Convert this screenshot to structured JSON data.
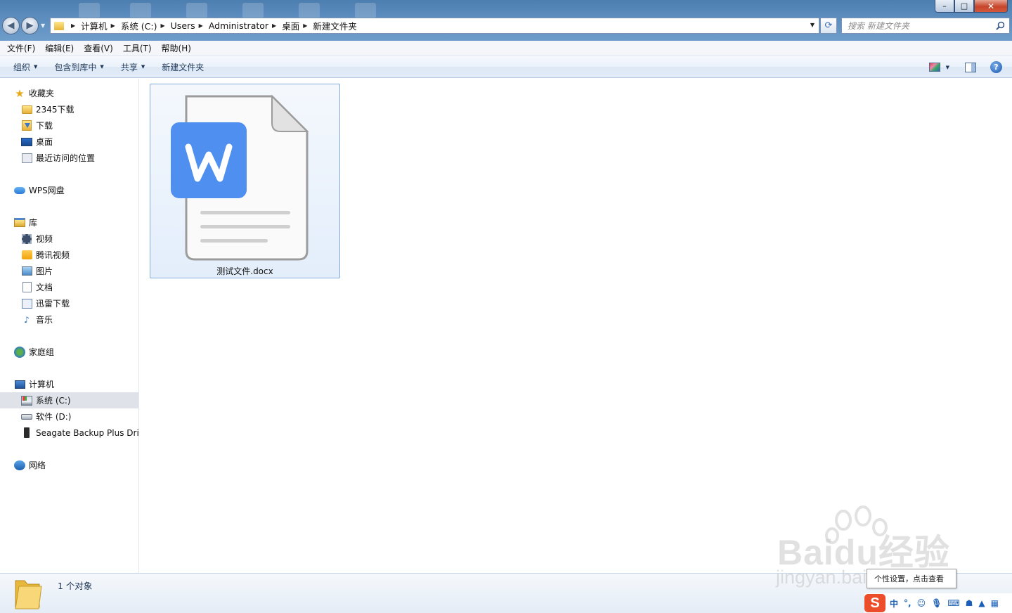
{
  "address": {
    "breadcrumbs": [
      "计算机",
      "系统 (C:)",
      "Users",
      "Administrator",
      "桌面",
      "新建文件夹"
    ]
  },
  "search": {
    "placeholder": "搜索 新建文件夹"
  },
  "window_controls": {
    "minimize": "–",
    "maximize": "□",
    "close": "✕"
  },
  "menubar": {
    "items": [
      "文件(F)",
      "编辑(E)",
      "查看(V)",
      "工具(T)",
      "帮助(H)"
    ]
  },
  "commandbar": {
    "organize": "组织",
    "include_in_library": "包含到库中",
    "share": "共享",
    "new_folder": "新建文件夹",
    "help": "?"
  },
  "sidebar": {
    "favorites": {
      "label": "收藏夹",
      "items": [
        "2345下载",
        "下载",
        "桌面",
        "最近访问的位置"
      ]
    },
    "wps_cloud": {
      "label": "WPS网盘"
    },
    "libraries": {
      "label": "库",
      "items": [
        "视频",
        "腾讯视频",
        "图片",
        "文档",
        "迅雷下载",
        "音乐"
      ]
    },
    "homegroup": {
      "label": "家庭组"
    },
    "computer": {
      "label": "计算机",
      "items": [
        "系统 (C:)",
        "软件 (D:)",
        "Seagate Backup Plus Drive"
      ],
      "selected": "系统 (C:)"
    },
    "network": {
      "label": "网络"
    }
  },
  "content": {
    "files": [
      {
        "name": "测试文件.docx",
        "type": "wps-word-document",
        "selected": true
      }
    ]
  },
  "details": {
    "count_text": "1 个对象"
  },
  "watermark": {
    "brand": "Baidu经验",
    "url": "jingyan.baidu.com"
  },
  "ime": {
    "tooltip": "个性设置，点击查看",
    "logo": "S",
    "mode": "中",
    "punct": "°,"
  },
  "colors": {
    "titlebar": "#5b8cbd",
    "wps_blue": "#4e8ff0",
    "selection": "#e3eefb",
    "selection_border": "#84acdd",
    "ime_red": "#ec4d2b"
  }
}
